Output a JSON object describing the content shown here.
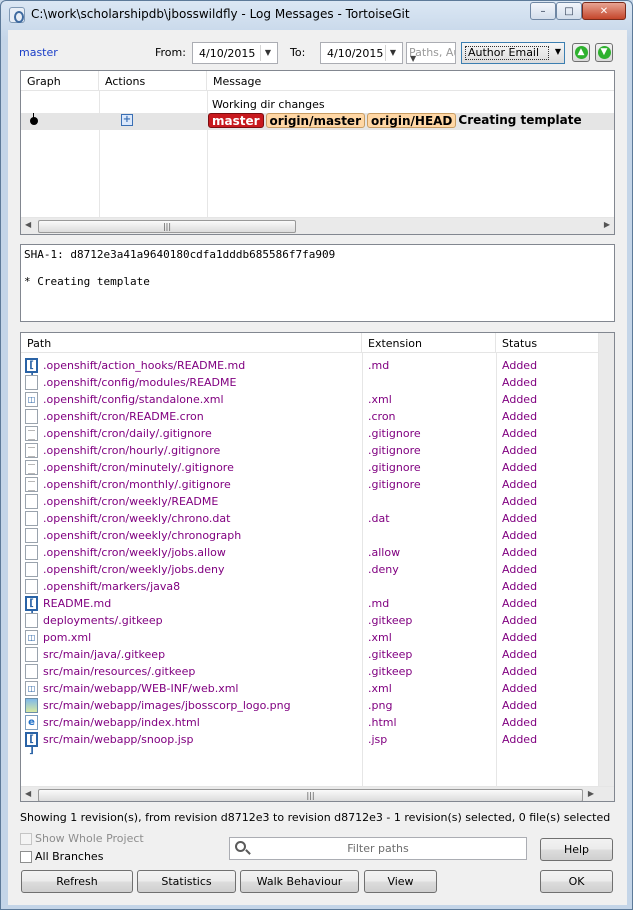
{
  "window": {
    "title": "C:\\work\\scholarshipdb\\jbosswildfly - Log Messages - TortoiseGit",
    "minimize": "–",
    "maximize": "□",
    "close": "✕"
  },
  "toolbar": {
    "branch": "master",
    "from_label": "From:",
    "from_date": "4/10/2015",
    "to_label": "To:",
    "to_date": "4/10/2015",
    "search_placeholder": "Paths, Au",
    "search_field": "Author Email"
  },
  "log": {
    "columns": [
      "Graph",
      "Actions",
      "Message"
    ],
    "working_dir": "Working dir changes",
    "commit": {
      "refs": [
        {
          "label": "master",
          "kind": "local"
        },
        {
          "label": "origin/master",
          "kind": "remote"
        },
        {
          "label": "origin/HEAD",
          "kind": "remote"
        }
      ],
      "message": "Creating template"
    }
  },
  "details": {
    "sha_line": "SHA-1: d8712e3a41a9640180cdfa1dddb685586f7fa909",
    "body": "* Creating template"
  },
  "files": {
    "columns": [
      "Path",
      "Extension",
      "Status"
    ],
    "rows": [
      {
        "path": ".openshift/action_hooks/README.md",
        "ext": ".md",
        "status": "Added",
        "icon": "bracket"
      },
      {
        "path": ".openshift/config/modules/README",
        "ext": "",
        "status": "Added",
        "icon": "blank"
      },
      {
        "path": ".openshift/config/standalone.xml",
        "ext": ".xml",
        "status": "Added",
        "icon": "xml"
      },
      {
        "path": ".openshift/cron/README.cron",
        "ext": ".cron",
        "status": "Added",
        "icon": "blank"
      },
      {
        "path": ".openshift/cron/daily/.gitignore",
        "ext": ".gitignore",
        "status": "Added",
        "icon": "txt"
      },
      {
        "path": ".openshift/cron/hourly/.gitignore",
        "ext": ".gitignore",
        "status": "Added",
        "icon": "txt"
      },
      {
        "path": ".openshift/cron/minutely/.gitignore",
        "ext": ".gitignore",
        "status": "Added",
        "icon": "txt"
      },
      {
        "path": ".openshift/cron/monthly/.gitignore",
        "ext": ".gitignore",
        "status": "Added",
        "icon": "txt"
      },
      {
        "path": ".openshift/cron/weekly/README",
        "ext": "",
        "status": "Added",
        "icon": "blank"
      },
      {
        "path": ".openshift/cron/weekly/chrono.dat",
        "ext": ".dat",
        "status": "Added",
        "icon": "blank"
      },
      {
        "path": ".openshift/cron/weekly/chronograph",
        "ext": "",
        "status": "Added",
        "icon": "blank"
      },
      {
        "path": ".openshift/cron/weekly/jobs.allow",
        "ext": ".allow",
        "status": "Added",
        "icon": "blank"
      },
      {
        "path": ".openshift/cron/weekly/jobs.deny",
        "ext": ".deny",
        "status": "Added",
        "icon": "blank"
      },
      {
        "path": ".openshift/markers/java8",
        "ext": "",
        "status": "Added",
        "icon": "blank"
      },
      {
        "path": "README.md",
        "ext": ".md",
        "status": "Added",
        "icon": "bracket"
      },
      {
        "path": "deployments/.gitkeep",
        "ext": ".gitkeep",
        "status": "Added",
        "icon": "blank"
      },
      {
        "path": "pom.xml",
        "ext": ".xml",
        "status": "Added",
        "icon": "xml"
      },
      {
        "path": "src/main/java/.gitkeep",
        "ext": ".gitkeep",
        "status": "Added",
        "icon": "blank"
      },
      {
        "path": "src/main/resources/.gitkeep",
        "ext": ".gitkeep",
        "status": "Added",
        "icon": "blank"
      },
      {
        "path": "src/main/webapp/WEB-INF/web.xml",
        "ext": ".xml",
        "status": "Added",
        "icon": "xml"
      },
      {
        "path": "src/main/webapp/images/jbosscorp_logo.png",
        "ext": ".png",
        "status": "Added",
        "icon": "img"
      },
      {
        "path": "src/main/webapp/index.html",
        "ext": ".html",
        "status": "Added",
        "icon": "html"
      },
      {
        "path": "src/main/webapp/snoop.jsp",
        "ext": ".jsp",
        "status": "Added",
        "icon": "bracket"
      }
    ]
  },
  "status_text": "Showing 1 revision(s), from revision d8712e3 to revision d8712e3 - 1 revision(s) selected, 0 file(s) selected",
  "options": {
    "show_whole_project": "Show Whole Project",
    "all_branches": "All Branches",
    "filter_placeholder": "Filter paths"
  },
  "buttons": {
    "help": "Help",
    "refresh": "Refresh",
    "statistics": "Statistics",
    "walk_behaviour": "Walk Behaviour",
    "view": "View",
    "ok": "OK"
  }
}
